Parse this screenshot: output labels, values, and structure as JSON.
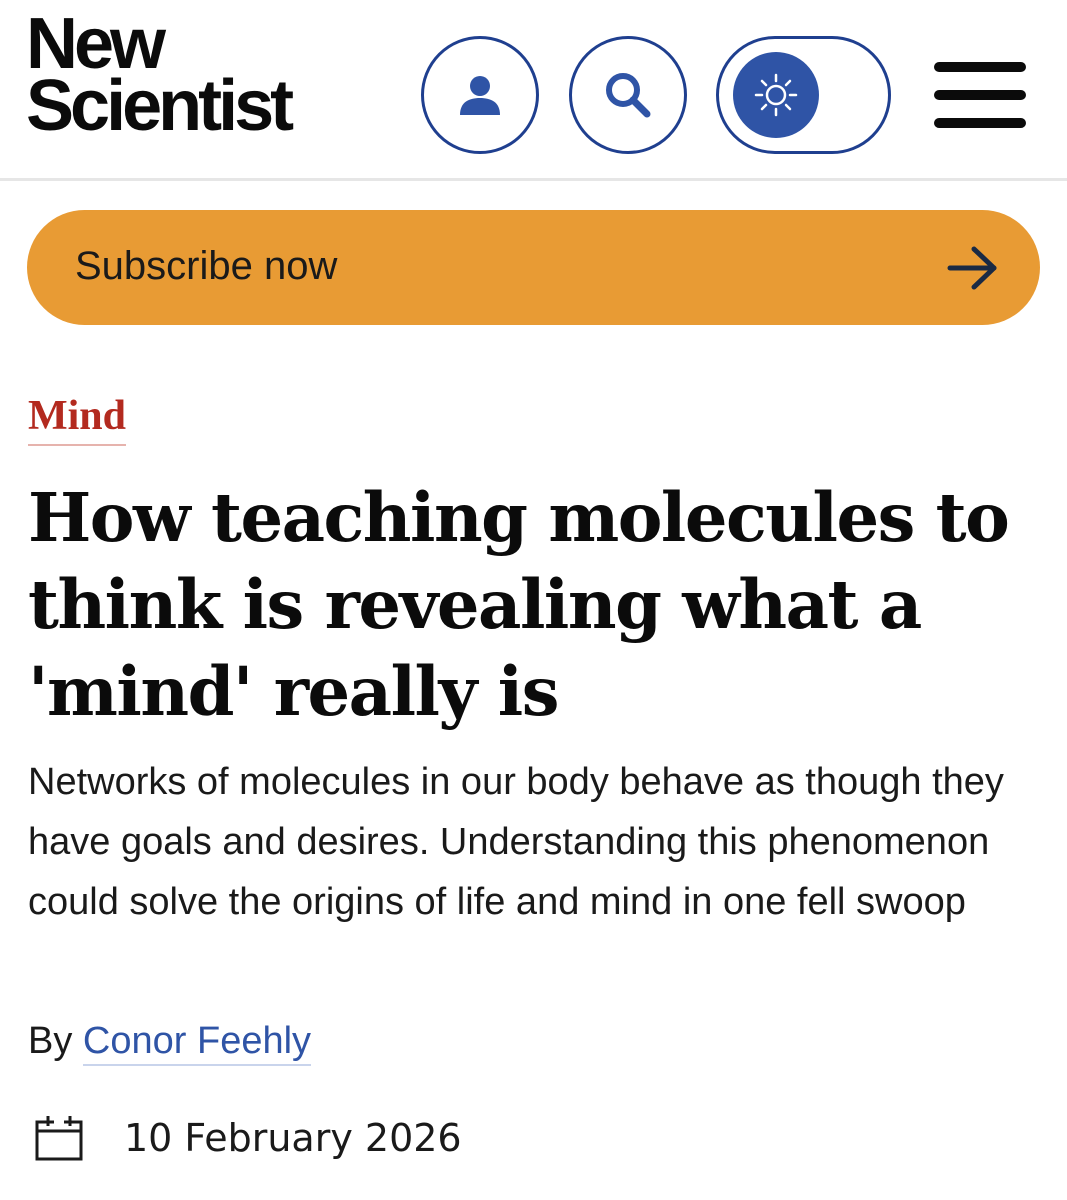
{
  "logo": {
    "line1": "New",
    "line2": "Scientist"
  },
  "header": {
    "icons": {
      "account": "user-icon",
      "search": "search-icon",
      "theme": "sun-icon",
      "menu": "hamburger-menu-icon"
    }
  },
  "subscribe": {
    "label": "Subscribe now",
    "icon": "arrow-right-icon"
  },
  "article": {
    "section": "Mind",
    "headline": "How teaching molecules to think is revealing what a 'mind' really is",
    "standfirst": "Networks of molecules in our body behave as though they have goals and desires. Understanding this phenomenon could solve the origins of life and mind in one fell swoop",
    "byline_prefix": "By",
    "author": "Conor Feehly",
    "date": "10 February 2026",
    "date_icon": "calendar-icon"
  },
  "colors": {
    "brand_blue": "#2f54a6",
    "outline_blue": "#1f3f8f",
    "subscribe_bg": "#e89b34",
    "section_red": "#b32a1f"
  }
}
